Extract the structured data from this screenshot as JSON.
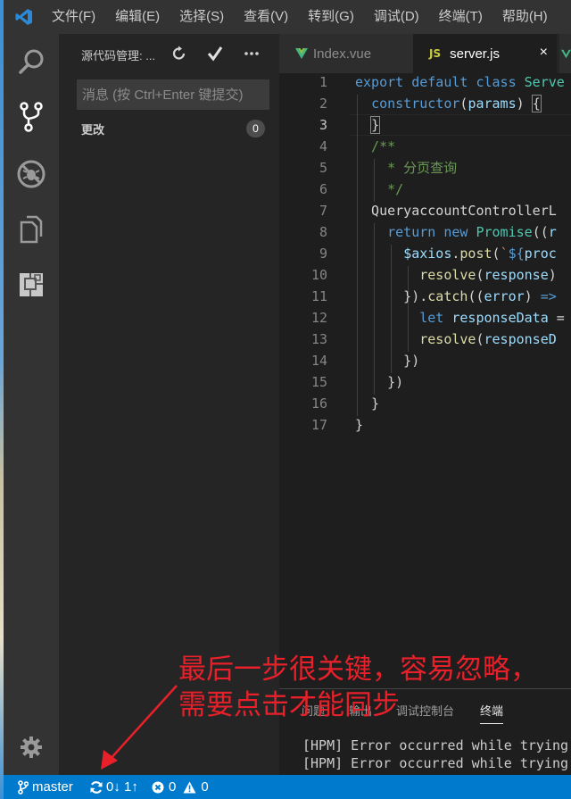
{
  "menu": [
    "文件(F)",
    "编辑(E)",
    "选择(S)",
    "查看(V)",
    "转到(G)",
    "调试(D)",
    "终端(T)",
    "帮助(H)"
  ],
  "activity_bar": {
    "items": [
      "search-icon",
      "source-control-icon",
      "debug-icon",
      "explorer-icon",
      "extensions-icon"
    ],
    "bottom": "gear-icon"
  },
  "sidebar": {
    "title": "源代码管理: ...",
    "actions": [
      "refresh-icon",
      "commit-check-icon",
      "more-actions-icon"
    ],
    "commit_placeholder": "消息 (按 Ctrl+Enter 键提交)",
    "commit_value": "",
    "changes_label": "更改",
    "changes_count": "0"
  },
  "tabs": [
    {
      "label": "Index.vue",
      "icon": "vue-icon",
      "active": false
    },
    {
      "label": "server.js",
      "icon": "js-icon",
      "active": true,
      "close": "×"
    }
  ],
  "editor": {
    "lines": [
      {
        "n": "1",
        "text": "export default class Serve"
      },
      {
        "n": "2",
        "text": "  constructor(params) {"
      },
      {
        "n": "3",
        "text": "  }"
      },
      {
        "n": "4",
        "text": "  /**"
      },
      {
        "n": "5",
        "text": "    * 分页查询"
      },
      {
        "n": "6",
        "text": "    */"
      },
      {
        "n": "7",
        "text": "  QueryaccountControllerL"
      },
      {
        "n": "8",
        "text": "    return new Promise((r"
      },
      {
        "n": "9",
        "text": "      $axios.post(`${proc"
      },
      {
        "n": "10",
        "text": "        resolve(response)"
      },
      {
        "n": "11",
        "text": "      }).catch((error) =>"
      },
      {
        "n": "12",
        "text": "        let responseData ="
      },
      {
        "n": "13",
        "text": "        resolve(responseD"
      },
      {
        "n": "14",
        "text": "      })"
      },
      {
        "n": "15",
        "text": "    })"
      },
      {
        "n": "16",
        "text": "  }"
      },
      {
        "n": "17",
        "text": "}"
      }
    ],
    "current_line": 3
  },
  "panel": {
    "tabs": [
      "问题",
      "输出",
      "调试控制台",
      "终端"
    ],
    "active_tab": "终端",
    "terminal_lines": [
      "[HPM] Error occurred while trying",
      "[HPM] Error occurred while trying"
    ]
  },
  "statusbar": {
    "branch": "master",
    "sync": "0↓ 1↑",
    "errors": "0",
    "warnings": "0"
  },
  "annotation": {
    "line1": "最后一步很关键，容易忽略，",
    "line2": "需要点击才能同步",
    "color": "#e8202a"
  }
}
